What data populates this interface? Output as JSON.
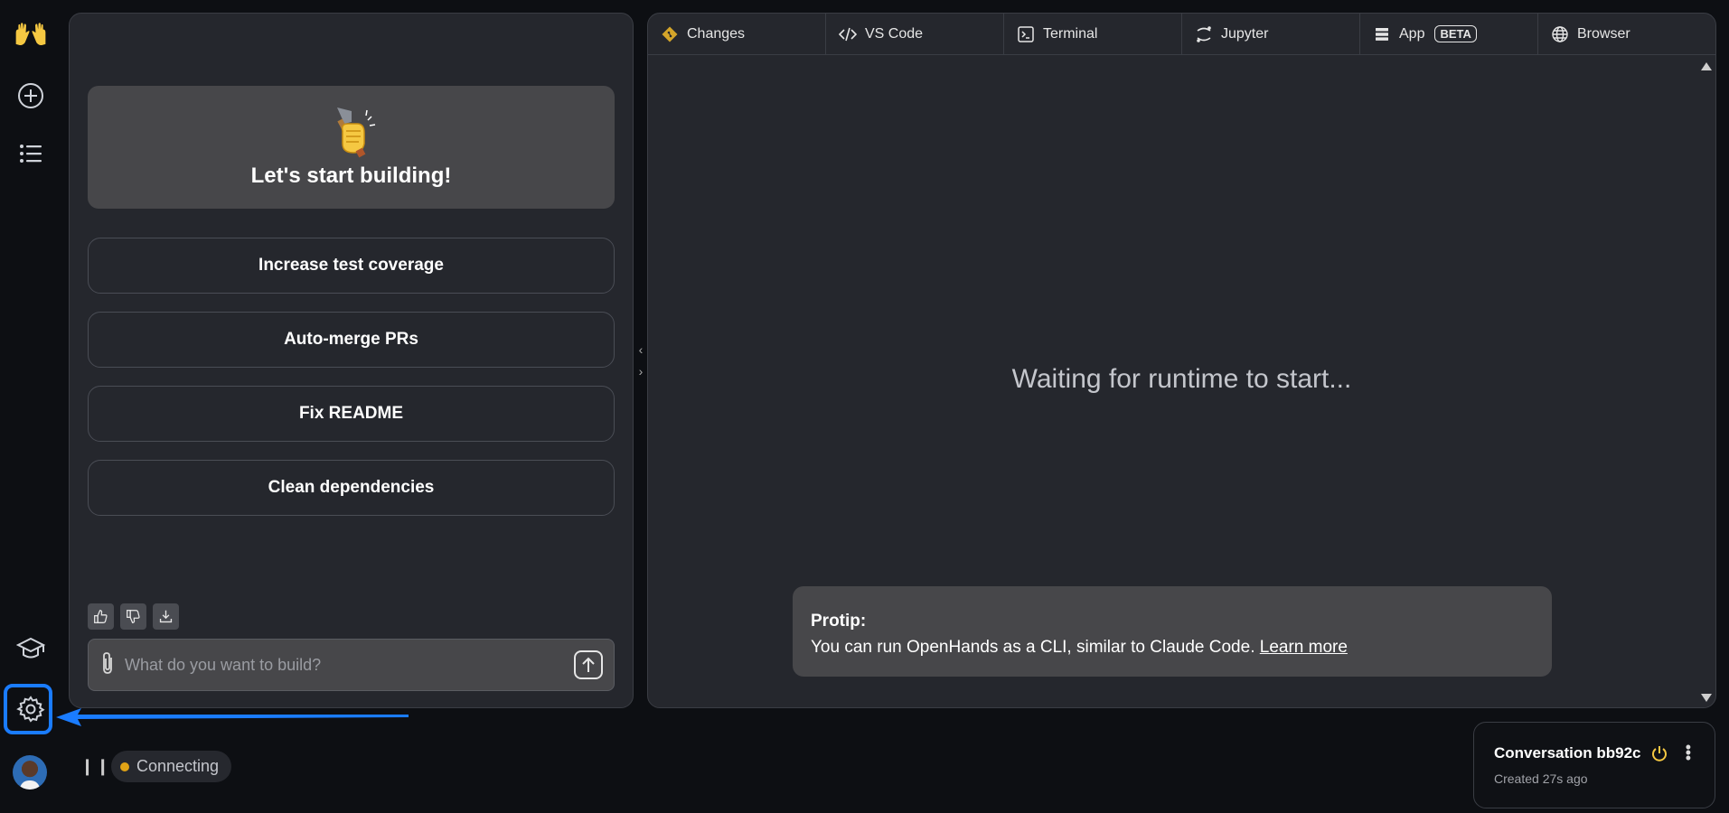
{
  "chat": {
    "hero_title": "Let's start building!",
    "suggestions": [
      "Increase test coverage",
      "Auto-merge PRs",
      "Fix README",
      "Clean dependencies"
    ],
    "input_placeholder": "What do you want to build?"
  },
  "workspace": {
    "tabs": [
      {
        "label": "Changes",
        "icon": "git-diamond-icon"
      },
      {
        "label": "VS Code",
        "icon": "code-icon"
      },
      {
        "label": "Terminal",
        "icon": "terminal-icon"
      },
      {
        "label": "Jupyter",
        "icon": "jupyter-icon"
      },
      {
        "label": "App",
        "icon": "app-icon",
        "badge": "BETA"
      },
      {
        "label": "Browser",
        "icon": "globe-icon"
      }
    ],
    "waiting_text": "Waiting for runtime to start...",
    "protip_title": "Protip:",
    "protip_text": "You can run OpenHands as a CLI, similar to Claude Code. ",
    "protip_link": "Learn more"
  },
  "status": {
    "label": "Connecting",
    "color": "#e0a316"
  },
  "conversation": {
    "title": "Conversation bb92c",
    "created": "Created 27s ago"
  },
  "colors": {
    "accent": "#1a7cff",
    "warning": "#f5c842"
  }
}
